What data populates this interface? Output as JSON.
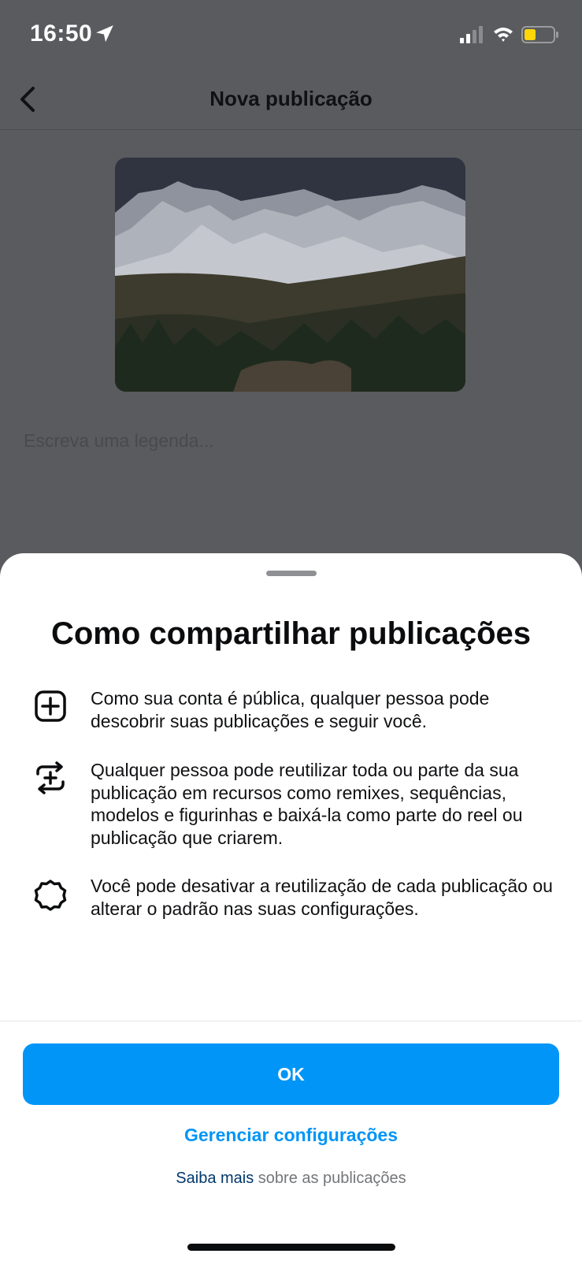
{
  "status_bar": {
    "time": "16:50"
  },
  "nav": {
    "title": "Nova publicação"
  },
  "composer": {
    "caption_placeholder": "Escreva uma legenda..."
  },
  "sheet": {
    "title": "Como compartilhar publicações",
    "items": [
      {
        "icon": "plus-square-icon",
        "text": "Como sua conta é pública, qualquer pessoa pode descobrir suas publicações e seguir você."
      },
      {
        "icon": "remix-icon",
        "text": "Qualquer pessoa pode reutilizar toda ou parte da sua publicação em recursos como remixes, sequências, modelos e figurinhas e baixá-la como parte do reel ou publicação que criarem."
      },
      {
        "icon": "gear-icon",
        "text": "Você pode desativar a reutilização de cada publicação ou alterar o padrão nas suas configurações."
      }
    ],
    "ok_label": "OK",
    "manage_label": "Gerenciar configurações",
    "learn_more_link": "Saiba mais",
    "learn_more_rest": " sobre as publicações"
  },
  "colors": {
    "accent": "#0095f6",
    "link_dark": "#00376b",
    "battery": "#ffd60a"
  }
}
